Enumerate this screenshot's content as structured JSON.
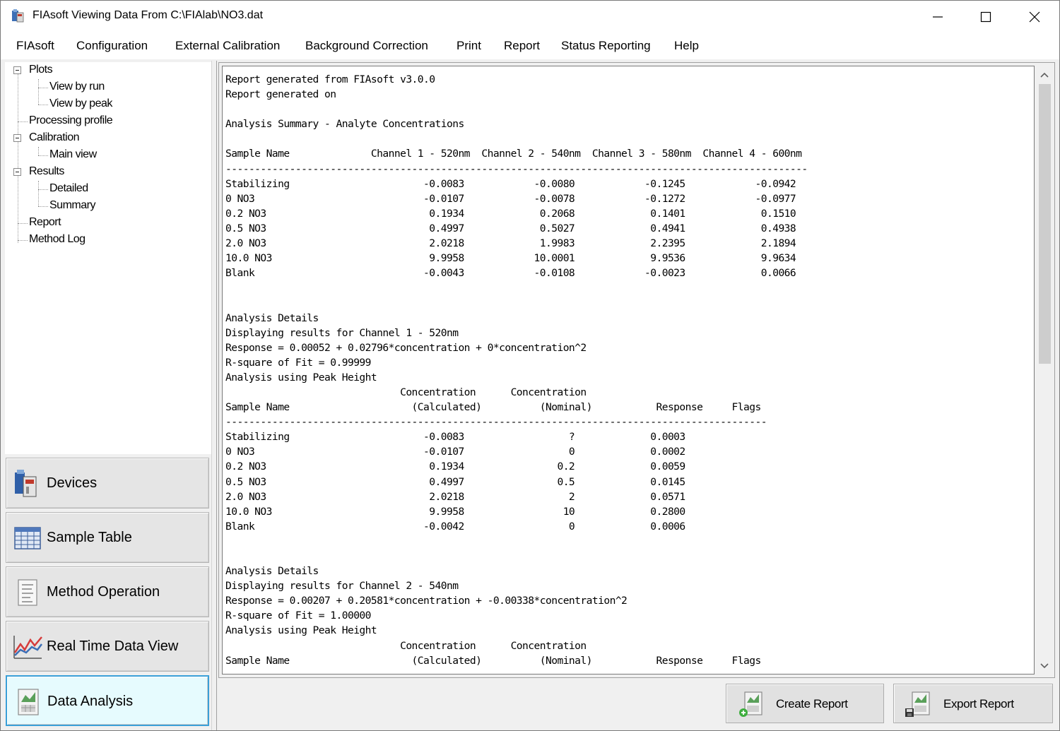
{
  "window": {
    "title": "FIAsoft Viewing Data From C:\\FIAlab\\NO3.dat",
    "minimize_icon": "minimize-icon",
    "maximize_icon": "maximize-icon",
    "close_icon": "close-icon"
  },
  "menu": {
    "items": [
      "FIAsoft",
      "Configuration",
      "External Calibration",
      "Background Correction",
      "Print",
      "Report",
      "Status Reporting",
      "Help"
    ]
  },
  "tree": {
    "plots": "Plots",
    "view_by_run": "View by run",
    "view_by_peak": "View by peak",
    "processing_profile": "Processing profile",
    "calibration": "Calibration",
    "main_view": "Main view",
    "results": "Results",
    "detailed": "Detailed",
    "summary": "Summary",
    "report": "Report",
    "method_log": "Method Log"
  },
  "nav": {
    "devices": "Devices",
    "sample_table": "Sample Table",
    "method_operation": "Method Operation",
    "real_time_data_view": "Real Time Data View",
    "data_analysis": "Data Analysis",
    "active": "data_analysis"
  },
  "report": {
    "lines": [
      "Report generated from FIAsoft v3.0.0",
      "Report generated on",
      "",
      "Analysis Summary - Analyte Concentrations",
      "",
      "Sample Name              Channel 1 - 520nm  Channel 2 - 540nm  Channel 3 - 580nm  Channel 4 - 600nm",
      "----------------------------------------------------------------------------------------------------",
      "Stabilizing                       -0.0083            -0.0080            -0.1245            -0.0942",
      "0 NO3                             -0.0107            -0.0078            -0.1272            -0.0977",
      "0.2 NO3                            0.1934             0.2068             0.1401             0.1510",
      "0.5 NO3                            0.4997             0.5027             0.4941             0.4938",
      "2.0 NO3                            2.0218             1.9983             2.2395             2.1894",
      "10.0 NO3                           9.9958            10.0001             9.9536             9.9634",
      "Blank                             -0.0043            -0.0108            -0.0023             0.0066",
      "",
      "",
      "Analysis Details",
      "Displaying results for Channel 1 - 520nm",
      "Response = 0.00052 + 0.02796*concentration + 0*concentration^2",
      "R-square of Fit = 0.99999",
      "Analysis using Peak Height",
      "                              Concentration      Concentration",
      "Sample Name                     (Calculated)          (Nominal)           Response     Flags",
      "---------------------------------------------------------------------------------------------",
      "Stabilizing                       -0.0083                  ?             0.0003",
      "0 NO3                             -0.0107                  0             0.0002",
      "0.2 NO3                            0.1934                0.2             0.0059",
      "0.5 NO3                            0.4997                0.5             0.0145",
      "2.0 NO3                            2.0218                  2             0.0571",
      "10.0 NO3                           9.9958                 10             0.2800",
      "Blank                             -0.0042                  0             0.0006",
      "",
      "",
      "Analysis Details",
      "Displaying results for Channel 2 - 540nm",
      "Response = 0.00207 + 0.20581*concentration + -0.00338*concentration^2",
      "R-square of Fit = 1.00000",
      "Analysis using Peak Height",
      "                              Concentration      Concentration",
      "Sample Name                     (Calculated)          (Nominal)           Response     Flags",
      "---------------------------------------------------------------------------------------------"
    ]
  },
  "buttons": {
    "create_report": "Create Report",
    "export_report": "Export Report"
  }
}
